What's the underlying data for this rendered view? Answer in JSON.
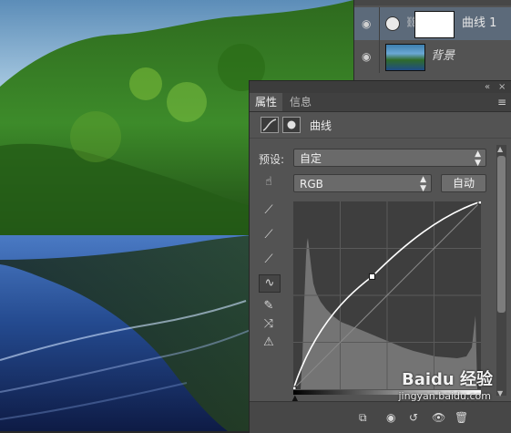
{
  "layers": {
    "items": [
      {
        "name": "曲线 1",
        "selected": true,
        "type": "adjustment"
      },
      {
        "name": "背景",
        "selected": false,
        "type": "background"
      }
    ],
    "top_icons": [
      "eye-icon",
      "link-icon",
      "new-icon"
    ]
  },
  "properties": {
    "tabs": [
      {
        "label": "属性",
        "active": true
      },
      {
        "label": "信息",
        "active": false
      }
    ],
    "header_title": "曲线",
    "preset_label": "预设:",
    "preset_value": "自定",
    "channel_value": "RGB",
    "auto_label": "自动",
    "tools": [
      "target-adjust-icon",
      "black-point-eyedropper-icon",
      "gray-point-eyedropper-icon",
      "white-point-eyedropper-icon",
      "curve-point-tool-icon",
      "pencil-tool-icon",
      "smooth-curve-icon",
      "clipping-warning-icon"
    ],
    "active_tool": "curve-point-tool-icon",
    "curve_points": [
      [
        0,
        0
      ],
      [
        0.42,
        0.6
      ],
      [
        1,
        1
      ]
    ]
  },
  "watermark": {
    "brand": "Baidu 经验",
    "url": "jingyan.baidu.com"
  },
  "colors": {
    "panel": "#535353",
    "dark": "#282828",
    "selected_layer": "#5c6a7a",
    "curve": "#ffffff"
  }
}
